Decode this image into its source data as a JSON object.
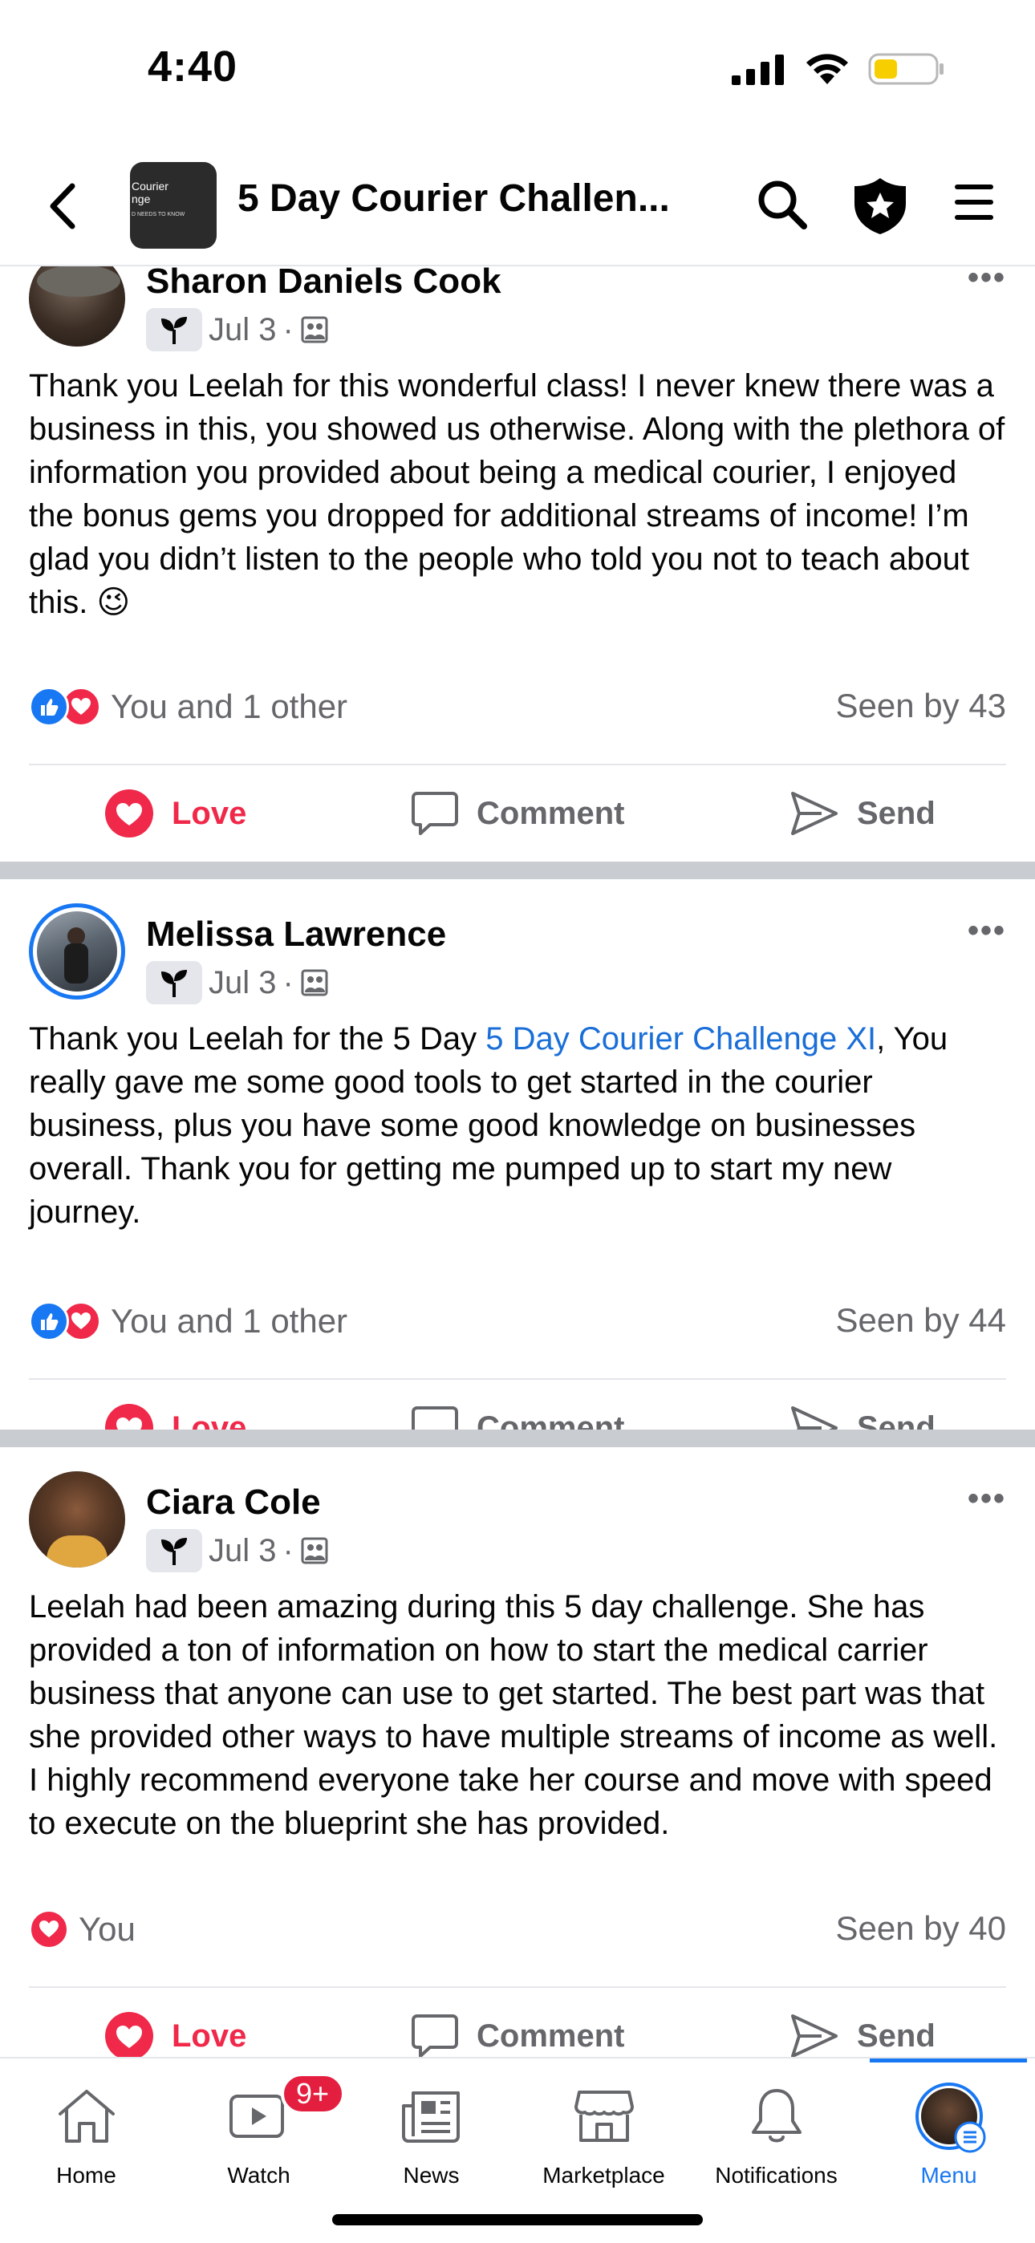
{
  "status_bar": {
    "time": "4:40"
  },
  "header": {
    "title": "5 Day Courier Challen...",
    "thumb_text_1": "Courier\nnge",
    "thumb_text_2": "D NEEDS TO KNOW"
  },
  "posts": [
    {
      "author": "Sharon Daniels Cook",
      "date": "Jul 3",
      "dot": "·",
      "text": "Thank you Leelah for this wonderful class! I never knew there was a business in this, you showed us otherwise. Along with the plethora of information you provided about being a medical courier, I enjoyed the bonus gems you dropped for additional streams of income! I’m glad you didn’t listen to the people who told you not to teach about this. 😉",
      "reactions": "You and 1 other",
      "seen": "Seen by 43",
      "more": "•••"
    },
    {
      "author": "Melissa Lawrence",
      "date": "Jul 3",
      "dot": "·",
      "text_before": "Thank you Leelah for the 5 Day ",
      "text_link": "5 Day Courier Challenge XI",
      "text_after": ", You really gave me some good tools to get started in the courier business, plus you have some good knowledge on businesses overall. Thank you for getting me pumped up to start my new journey.",
      "reactions": "You and 1 other",
      "seen": "Seen by 44",
      "more": "•••"
    },
    {
      "author": "Ciara Cole",
      "date": "Jul 3",
      "dot": "·",
      "text": "Leelah had been amazing during this 5 day challenge. She has provided a ton of information on how to start the medical carrier business that anyone can use to get started. The best part was that she provided other ways to have multiple streams of income as well. I highly recommend everyone take her course and move with speed to execute on the blueprint she has provided.",
      "reactions": "You",
      "seen": "Seen by 40",
      "more": "•••"
    }
  ],
  "actions": {
    "love": "Love",
    "comment": "Comment",
    "send": "Send"
  },
  "tabs": [
    {
      "label": "Home",
      "icon": "home-icon"
    },
    {
      "label": "Watch",
      "icon": "watch-icon",
      "badge": "9+"
    },
    {
      "label": "News",
      "icon": "news-icon"
    },
    {
      "label": "Marketplace",
      "icon": "marketplace-icon"
    },
    {
      "label": "Notifications",
      "icon": "bell-icon"
    },
    {
      "label": "Menu",
      "icon": "avatar",
      "active": true
    }
  ],
  "colors": {
    "accent": "#1877f2",
    "love": "#f02849",
    "separator": "#c9ccd1",
    "muted": "#65676b"
  }
}
